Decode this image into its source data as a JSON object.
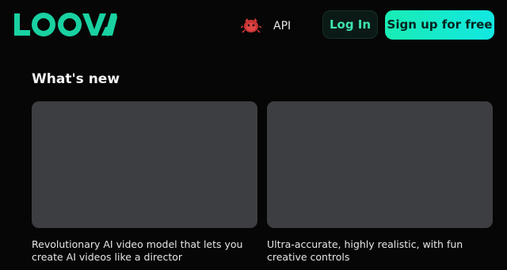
{
  "header": {
    "logo_text": "LOOVA",
    "nav": {
      "icon_name": "bug-mascot-icon",
      "api_label": "API"
    },
    "login_label": "Log In",
    "signup_label": "Sign up for free"
  },
  "colors": {
    "background": "#060606",
    "brand_green": "#19d1a1",
    "signup_gradient_start": "#19ecb4",
    "signup_gradient_end": "#12e7e2",
    "card_placeholder": "#3d3e42"
  },
  "whats_new": {
    "title": "What's new",
    "cards": [
      {
        "description": "Revolutionary AI video model that lets you create AI videos like a director"
      },
      {
        "description": "Ultra-accurate, highly realistic, with fun creative controls"
      }
    ]
  }
}
